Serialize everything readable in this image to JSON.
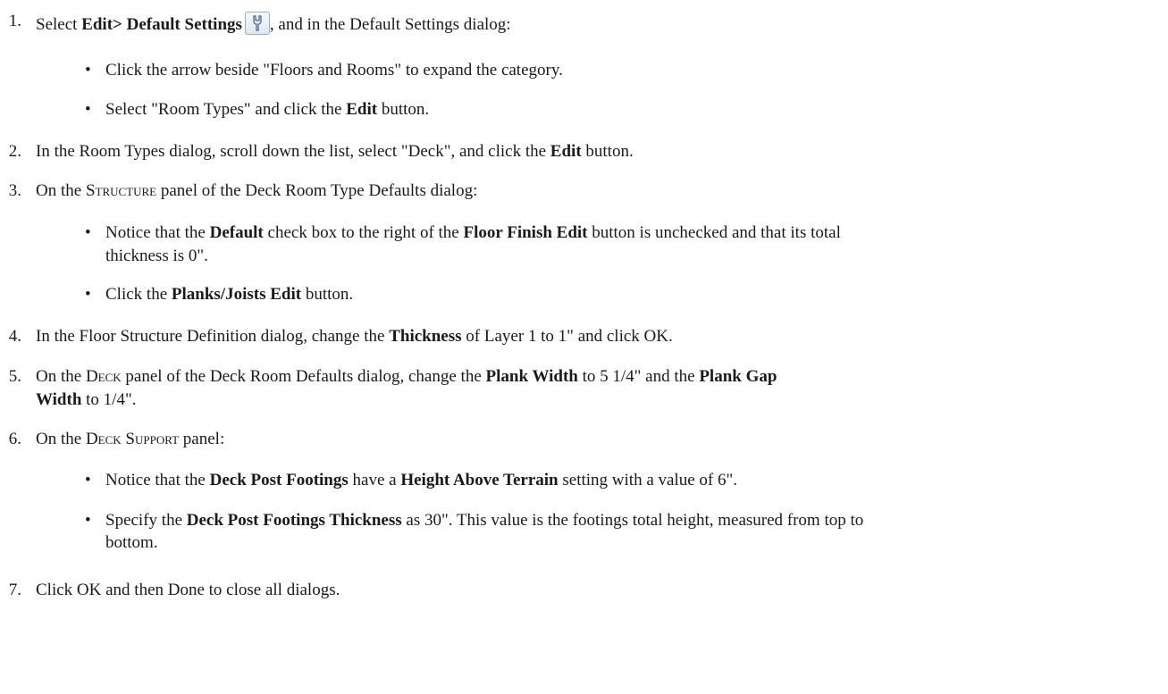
{
  "steps": [
    {
      "num": "1.",
      "parts": [
        {
          "t": "Select "
        },
        {
          "t": "Edit> Default Settings",
          "b": true
        },
        {
          "icon": "wrench-icon"
        },
        {
          "t": ", and in the Default Settings dialog:"
        }
      ]
    },
    {
      "bullet": true,
      "parts": [
        {
          "t": "Click the arrow beside \"Floors and Rooms\" to expand the category."
        }
      ]
    },
    {
      "bullet": true,
      "parts": [
        {
          "t": "Select \"Room Types\" and click the "
        },
        {
          "t": "Edit",
          "b": true
        },
        {
          "t": " button."
        }
      ]
    },
    {
      "num": "2.",
      "parts": [
        {
          "t": "In the Room Types dialog, scroll down the list, select \"Deck\", and click the "
        },
        {
          "t": "Edit",
          "b": true
        },
        {
          "t": " button."
        }
      ]
    },
    {
      "num": "3.",
      "parts": [
        {
          "t": "On the "
        },
        {
          "t": "Structure",
          "sc": true
        },
        {
          "t": " panel of the Deck Room Type Defaults dialog:"
        }
      ]
    },
    {
      "bullet": true,
      "parts": [
        {
          "t": "Notice that the "
        },
        {
          "t": "Default",
          "b": true
        },
        {
          "t": " check box to the right of the "
        },
        {
          "t": "Floor Finish Edit",
          "b": true
        },
        {
          "t": " button is unchecked and that its total"
        }
      ]
    },
    {
      "cont": true,
      "parts": [
        {
          "t": "thickness is 0\"."
        }
      ]
    },
    {
      "bullet": true,
      "parts": [
        {
          "t": "Click the "
        },
        {
          "t": "Planks/Joists Edit",
          "b": true
        },
        {
          "t": " button."
        }
      ]
    },
    {
      "num": "4.",
      "parts": [
        {
          "t": "In the Floor Structure Definition dialog, change the "
        },
        {
          "t": "Thickness",
          "b": true
        },
        {
          "t": " of Layer 1 to 1\" and click OK."
        }
      ]
    },
    {
      "num": "5.",
      "parts": [
        {
          "t": "On the "
        },
        {
          "t": "Deck",
          "sc": true
        },
        {
          "t": " panel of the Deck Room Defaults dialog, change the "
        },
        {
          "t": "Plank Width",
          "b": true
        },
        {
          "t": " to 5 1/4\" and the "
        },
        {
          "t": "Plank Gap",
          "b": true
        }
      ]
    },
    {
      "cont": true,
      "parts": [
        {
          "t": "Width",
          "b": true
        },
        {
          "t": " to 1/4\"."
        }
      ]
    },
    {
      "num": "6.",
      "parts": [
        {
          "t": "On the "
        },
        {
          "t": "Deck Support",
          "sc": true
        },
        {
          "t": " panel:"
        }
      ]
    },
    {
      "bullet": true,
      "parts": [
        {
          "t": "Notice that the "
        },
        {
          "t": "Deck Post Footings",
          "b": true
        },
        {
          "t": " have a "
        },
        {
          "t": "Height Above Terrain",
          "b": true
        },
        {
          "t": " setting with a value of 6\"."
        }
      ]
    },
    {
      "bullet": true,
      "parts": [
        {
          "t": "Specify the "
        },
        {
          "t": "Deck Post Footings Thickness",
          "b": true
        },
        {
          "t": " as 30\". This value is the footings total height, measured from top to"
        }
      ]
    },
    {
      "cont": true,
      "parts": [
        {
          "t": "bottom."
        }
      ]
    },
    {
      "num": "7.",
      "parts": [
        {
          "t": "Click OK and then Done to close all dialogs."
        }
      ]
    }
  ]
}
